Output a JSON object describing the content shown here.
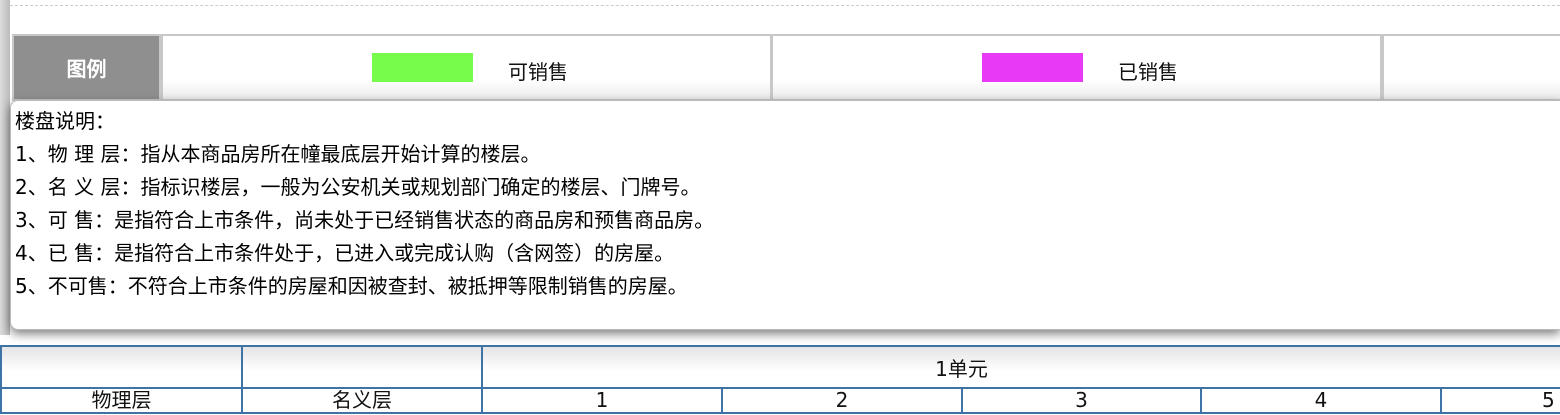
{
  "legend": {
    "title": "图例",
    "items": [
      {
        "label": "可销售",
        "color": "#77fc4b"
      },
      {
        "label": "已销售",
        "color": "#e83af6"
      }
    ]
  },
  "description": {
    "title": "楼盘说明：",
    "lines": [
      "1、物 理 层：指从本商品房所在幢最底层开始计算的楼层。",
      "2、名 义 层：指标识楼层，一般为公安机关或规划部门确定的楼层、门牌号。",
      "3、可 售：是指符合上市条件，尚未处于已经销售状态的商品房和预售商品房。",
      "4、已 售：是指符合上市条件处于，已进入或完成认购（含网签）的房屋。",
      "5、不可售：不符合上市条件的房屋和因被查封、被抵押等限制销售的房屋。"
    ]
  },
  "table": {
    "unit": "1单元",
    "headers": [
      "物理层",
      "名义层",
      "1",
      "2",
      "3",
      "4",
      "5"
    ]
  }
}
